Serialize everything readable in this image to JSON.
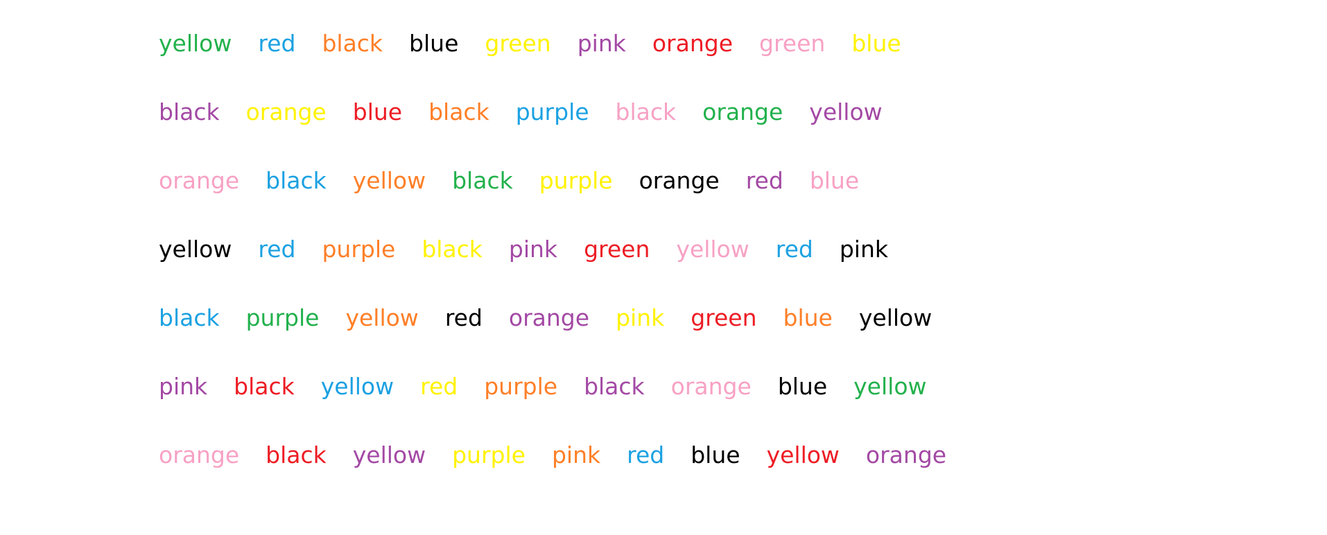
{
  "palette": {
    "red": "#ED1C24",
    "blue": "#1BA1E2",
    "black": "#000000",
    "green": "#22B14C",
    "yellow": "#FFF200",
    "pink": "#F7A1C4",
    "orange": "#FF7F27",
    "purple": "#A349A4"
  },
  "rows": [
    [
      {
        "text": "yellow",
        "ink": "green"
      },
      {
        "text": "red",
        "ink": "blue"
      },
      {
        "text": "black",
        "ink": "orange"
      },
      {
        "text": "blue",
        "ink": "black"
      },
      {
        "text": "green",
        "ink": "yellow"
      },
      {
        "text": "pink",
        "ink": "purple"
      },
      {
        "text": "orange",
        "ink": "red"
      },
      {
        "text": "green",
        "ink": "pink"
      },
      {
        "text": "blue",
        "ink": "yellow"
      }
    ],
    [
      {
        "text": "black",
        "ink": "purple"
      },
      {
        "text": "orange",
        "ink": "yellow"
      },
      {
        "text": "blue",
        "ink": "red"
      },
      {
        "text": "black",
        "ink": "orange"
      },
      {
        "text": "purple",
        "ink": "blue"
      },
      {
        "text": "black",
        "ink": "pink"
      },
      {
        "text": "orange",
        "ink": "green"
      },
      {
        "text": "yellow",
        "ink": "purple"
      }
    ],
    [
      {
        "text": "orange",
        "ink": "pink"
      },
      {
        "text": "black",
        "ink": "blue"
      },
      {
        "text": "yellow",
        "ink": "orange"
      },
      {
        "text": "black",
        "ink": "green"
      },
      {
        "text": "purple",
        "ink": "yellow"
      },
      {
        "text": "orange",
        "ink": "black"
      },
      {
        "text": "red",
        "ink": "purple"
      },
      {
        "text": "blue",
        "ink": "pink"
      }
    ],
    [
      {
        "text": "yellow",
        "ink": "black"
      },
      {
        "text": "red",
        "ink": "blue"
      },
      {
        "text": "purple",
        "ink": "orange"
      },
      {
        "text": "black",
        "ink": "yellow"
      },
      {
        "text": "pink",
        "ink": "purple"
      },
      {
        "text": "green",
        "ink": "red"
      },
      {
        "text": "yellow",
        "ink": "pink"
      },
      {
        "text": "red",
        "ink": "blue"
      },
      {
        "text": "pink",
        "ink": "black"
      }
    ],
    [
      {
        "text": "black",
        "ink": "blue"
      },
      {
        "text": "purple",
        "ink": "green"
      },
      {
        "text": "yellow",
        "ink": "orange"
      },
      {
        "text": "red",
        "ink": "black"
      },
      {
        "text": "orange",
        "ink": "purple"
      },
      {
        "text": "pink",
        "ink": "yellow"
      },
      {
        "text": "green",
        "ink": "red"
      },
      {
        "text": "blue",
        "ink": "orange"
      },
      {
        "text": "yellow",
        "ink": "black"
      }
    ],
    [
      {
        "text": "pink",
        "ink": "purple"
      },
      {
        "text": "black",
        "ink": "red"
      },
      {
        "text": "yellow",
        "ink": "blue"
      },
      {
        "text": "red",
        "ink": "yellow"
      },
      {
        "text": "purple",
        "ink": "orange"
      },
      {
        "text": "black",
        "ink": "purple"
      },
      {
        "text": "orange",
        "ink": "pink"
      },
      {
        "text": "blue",
        "ink": "black"
      },
      {
        "text": "yellow",
        "ink": "green"
      }
    ],
    [
      {
        "text": "orange",
        "ink": "pink"
      },
      {
        "text": "black",
        "ink": "red"
      },
      {
        "text": "yellow",
        "ink": "purple"
      },
      {
        "text": "purple",
        "ink": "yellow"
      },
      {
        "text": "pink",
        "ink": "orange"
      },
      {
        "text": "red",
        "ink": "blue"
      },
      {
        "text": "blue",
        "ink": "black"
      },
      {
        "text": "yellow",
        "ink": "red"
      },
      {
        "text": "orange",
        "ink": "purple"
      }
    ]
  ]
}
